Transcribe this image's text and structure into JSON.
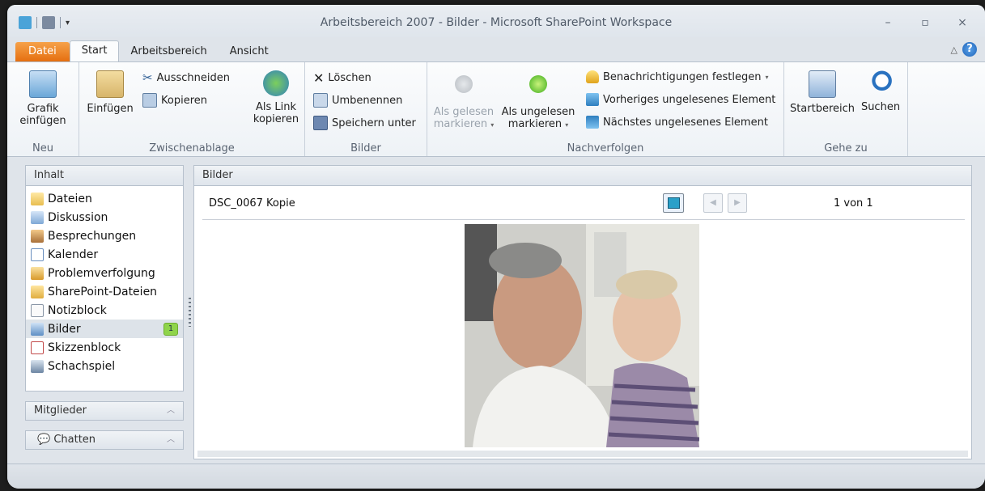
{
  "window": {
    "title": "Arbeitsbereich 2007 - Bilder  -  Microsoft SharePoint Workspace",
    "controls": [
      "minimize-icon",
      "maximize-icon",
      "close-icon"
    ]
  },
  "tabs": [
    "Datei",
    "Start",
    "Arbeitsbereich",
    "Ansicht"
  ],
  "ribbon": {
    "neu": {
      "label": "Neu",
      "grafik": [
        "Grafik",
        "einfügen"
      ]
    },
    "zwischenablage": {
      "label": "Zwischenablage",
      "einfuegen": "Einfügen",
      "ausschneiden": "Ausschneiden",
      "kopieren": "Kopieren",
      "als_link": [
        "Als Link",
        "kopieren"
      ]
    },
    "bilder": {
      "label": "Bilder",
      "loeschen": "Löschen",
      "umbenennen": "Umbenennen",
      "speichern": "Speichern unter"
    },
    "nachverfolgen": {
      "label": "Nachverfolgen",
      "gelesen": [
        "Als gelesen",
        "markieren"
      ],
      "ungelesen": [
        "Als ungelesen",
        "markieren"
      ],
      "benachrichtigungen": "Benachrichtigungen festlegen",
      "vorheriges": "Vorheriges ungelesenes Element",
      "naechstes": "Nächstes ungelesenes Element"
    },
    "gehezu": {
      "label": "Gehe zu",
      "startbereich": "Startbereich",
      "suchen": "Suchen"
    }
  },
  "sidebar": {
    "header": "Inhalt",
    "items": [
      {
        "label": "Dateien",
        "icon": "folder-icon"
      },
      {
        "label": "Diskussion",
        "icon": "discussion-icon"
      },
      {
        "label": "Besprechungen",
        "icon": "meetings-icon"
      },
      {
        "label": "Kalender",
        "icon": "calendar-icon"
      },
      {
        "label": "Problemverfolgung",
        "icon": "issue-tracking-icon"
      },
      {
        "label": "SharePoint-Dateien",
        "icon": "sharepoint-folder-icon"
      },
      {
        "label": "Notizblock",
        "icon": "notepad-icon"
      },
      {
        "label": "Bilder",
        "icon": "pictures-icon",
        "badge": "1"
      },
      {
        "label": "Skizzenblock",
        "icon": "sketchpad-icon"
      },
      {
        "label": "Schachspiel",
        "icon": "chess-icon"
      }
    ],
    "mitglieder": "Mitglieder",
    "chatten": "Chatten"
  },
  "main": {
    "header": "Bilder",
    "document": "DSC_0067 Kopie",
    "page_info": "1 von 1"
  }
}
